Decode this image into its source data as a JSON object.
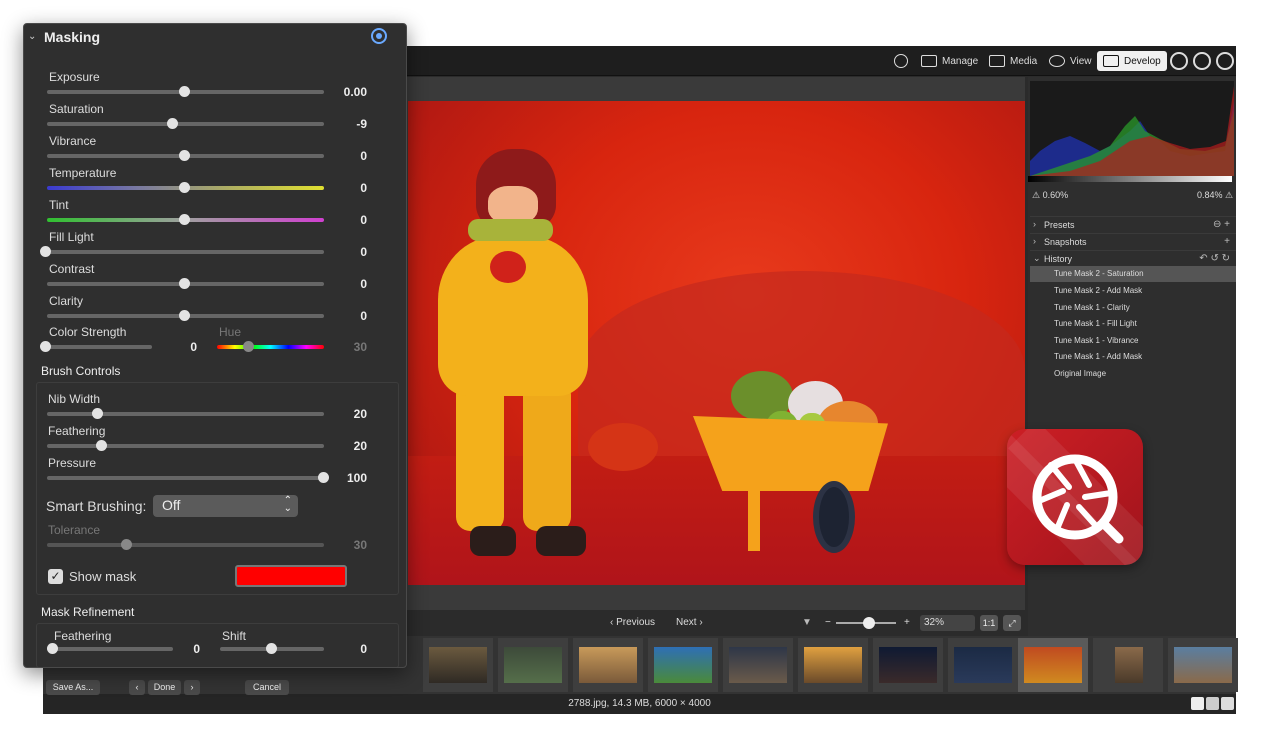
{
  "topbar": {
    "modes": [
      {
        "label": "Manage"
      },
      {
        "label": "Media"
      },
      {
        "label": "View"
      },
      {
        "label": "Develop"
      }
    ]
  },
  "navbar": {
    "previous": "Previous",
    "next": "Next",
    "zoom": "32%",
    "one_to_one": "1:1"
  },
  "status": {
    "file_info": "2788.jpg, 14.3 MB, 6000 × 4000"
  },
  "histogram": {
    "shadow_clip": "0.60%",
    "highlight_clip": "0.84%"
  },
  "right_panel": {
    "sections": [
      {
        "label": "Presets"
      },
      {
        "label": "Snapshots"
      },
      {
        "label": "History"
      }
    ],
    "history_items": [
      "Tune Mask 2 - Saturation",
      "Tune Mask 2 - Add Mask",
      "Tune Mask 1 - Clarity",
      "Tune Mask 1 - Fill Light",
      "Tune Mask 1 - Vibrance",
      "Tune Mask 1 - Add Mask",
      "Original Image"
    ]
  },
  "masking": {
    "title": "Masking",
    "sliders": [
      {
        "label": "Exposure",
        "value": "0.00"
      },
      {
        "label": "Saturation",
        "value": "-9"
      },
      {
        "label": "Vibrance",
        "value": "0"
      },
      {
        "label": "Temperature",
        "value": "0"
      },
      {
        "label": "Tint",
        "value": "0"
      },
      {
        "label": "Fill Light",
        "value": "0"
      },
      {
        "label": "Contrast",
        "value": "0"
      },
      {
        "label": "Clarity",
        "value": "0"
      }
    ],
    "color_strength": {
      "label": "Color Strength",
      "value": "0"
    },
    "hue": {
      "label": "Hue",
      "value": "30"
    },
    "brush_controls": {
      "title": "Brush Controls",
      "nib_width": {
        "label": "Nib Width",
        "value": "20"
      },
      "feathering": {
        "label": "Feathering",
        "value": "20"
      },
      "pressure": {
        "label": "Pressure",
        "value": "100"
      },
      "smart_brushing_label": "Smart Brushing:",
      "smart_brushing_value": "Off",
      "tolerance": {
        "label": "Tolerance",
        "value": "30"
      },
      "show_mask_label": "Show mask",
      "mask_color": "#ff0000"
    },
    "mask_refinement": {
      "title": "Mask Refinement",
      "feathering": {
        "label": "Feathering",
        "value": "0"
      },
      "shift": {
        "label": "Shift",
        "value": "0"
      }
    }
  },
  "footer_buttons": {
    "save_as": "Save As...",
    "done": "Done",
    "cancel": "Cancel"
  },
  "colors": {
    "mask_overlay": "#d8250f",
    "logo_red": "#c41e24",
    "accent_blue": "#6aa9ff"
  }
}
